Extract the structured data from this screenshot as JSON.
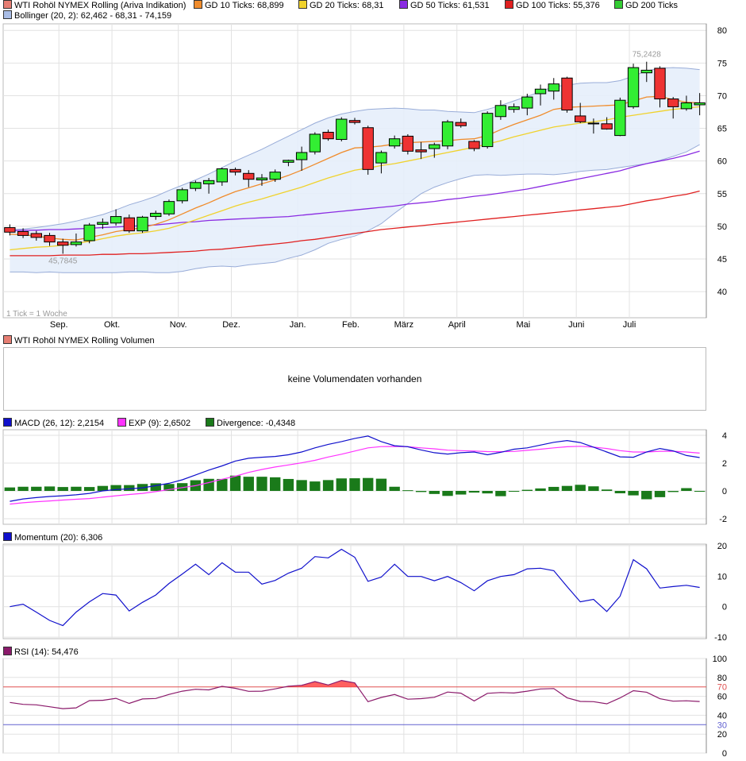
{
  "legend_main_1": [
    {
      "label": "WTI Rohöl NYMEX Rolling (Ariva Indikation)",
      "color": "#e67e73"
    },
    {
      "label": "GD 10 Ticks: 68,899",
      "color": "#f08c2c"
    },
    {
      "label": "GD 20 Ticks: 68,31",
      "color": "#f0d22c"
    },
    {
      "label": "GD 50 Ticks: 61,531",
      "color": "#8a2be2"
    },
    {
      "label": "GD 100 Ticks: 55,376",
      "color": "#e02020"
    },
    {
      "label": "GD 200 Ticks",
      "color": "#33cc33"
    }
  ],
  "legend_main_2": {
    "label": "Bollinger (20, 2): 62,462 - 68,31 - 74,159",
    "color": "#a9bde6"
  },
  "legend_volume": {
    "label": "WTI Rohöl NYMEX Rolling Volumen",
    "color": "#e67e73"
  },
  "no_volume_text": "keine Volumendaten vorhanden",
  "legend_macd": [
    {
      "label": "MACD (26, 12): 2,2154",
      "color": "#1010cc"
    },
    {
      "label": "EXP (9): 2,6502",
      "color": "#ff33ff"
    },
    {
      "label": "Divergence: -0,4348",
      "color": "#1a7a1a"
    }
  ],
  "legend_momentum": {
    "label": "Momentum (20): 6,306",
    "color": "#1010cc"
  },
  "legend_rsi": {
    "label": "RSI (14): 54,476",
    "color": "#8b1a6b"
  },
  "tick_note": "1 Tick = 1 Woche",
  "colors": {
    "up": "#33ee33",
    "down": "#ee3333",
    "band_fill": "#e6eefb",
    "band_line": "#98acd8"
  },
  "chart_data": [
    {
      "type": "candlestick",
      "x_labels": [
        "Sep.",
        "Okt.",
        "Nov.",
        "Dez.",
        "Jan.",
        "Feb.",
        "März",
        "April",
        "Mai",
        "Juni",
        "Juli"
      ],
      "x_label_positions": [
        4.2,
        8.2,
        13.2,
        17.2,
        22.2,
        26.2,
        30.2,
        34.2,
        39.2,
        43.2,
        47.2
      ],
      "ylim": [
        36,
        81
      ],
      "yticks": [
        40,
        45,
        50,
        55,
        60,
        65,
        70,
        75,
        80
      ],
      "annotations": [
        {
          "text": "75,2428",
          "x": 48,
          "y": 75.24
        },
        {
          "text": "45,7845",
          "x": 4,
          "y": 45.78
        }
      ],
      "candles": [
        {
          "o": 49.8,
          "h": 50.3,
          "l": 48.6,
          "c": 49.1
        },
        {
          "o": 49.2,
          "h": 49.7,
          "l": 48.2,
          "c": 48.6
        },
        {
          "o": 48.9,
          "h": 49.3,
          "l": 47.8,
          "c": 48.3
        },
        {
          "o": 48.6,
          "h": 49.0,
          "l": 47.0,
          "c": 47.6
        },
        {
          "o": 47.6,
          "h": 48.1,
          "l": 45.8,
          "c": 47.1
        },
        {
          "o": 47.2,
          "h": 48.9,
          "l": 46.9,
          "c": 47.6
        },
        {
          "o": 47.8,
          "h": 50.5,
          "l": 47.4,
          "c": 50.2
        },
        {
          "o": 50.3,
          "h": 51.2,
          "l": 49.6,
          "c": 50.6
        },
        {
          "o": 50.5,
          "h": 52.6,
          "l": 50.1,
          "c": 51.5
        },
        {
          "o": 51.3,
          "h": 51.8,
          "l": 49.0,
          "c": 49.3
        },
        {
          "o": 49.3,
          "h": 51.6,
          "l": 49.0,
          "c": 51.4
        },
        {
          "o": 51.5,
          "h": 52.4,
          "l": 51.0,
          "c": 52.0
        },
        {
          "o": 51.9,
          "h": 54.1,
          "l": 51.6,
          "c": 53.8
        },
        {
          "o": 53.9,
          "h": 55.9,
          "l": 53.5,
          "c": 55.6
        },
        {
          "o": 55.8,
          "h": 57.0,
          "l": 55.4,
          "c": 56.7
        },
        {
          "o": 56.5,
          "h": 57.4,
          "l": 55.0,
          "c": 57.0
        },
        {
          "o": 56.8,
          "h": 59.0,
          "l": 56.2,
          "c": 58.8
        },
        {
          "o": 58.7,
          "h": 59.0,
          "l": 57.8,
          "c": 58.3
        },
        {
          "o": 58.1,
          "h": 58.6,
          "l": 56.0,
          "c": 57.2
        },
        {
          "o": 57.1,
          "h": 58.0,
          "l": 56.2,
          "c": 57.4
        },
        {
          "o": 57.2,
          "h": 58.7,
          "l": 56.8,
          "c": 58.3
        },
        {
          "o": 59.8,
          "h": 60.2,
          "l": 59.2,
          "c": 60.1
        },
        {
          "o": 60.2,
          "h": 62.2,
          "l": 58.5,
          "c": 61.3
        },
        {
          "o": 61.4,
          "h": 64.4,
          "l": 61.0,
          "c": 64.1
        },
        {
          "o": 64.4,
          "h": 64.8,
          "l": 63.1,
          "c": 63.4
        },
        {
          "o": 63.3,
          "h": 66.7,
          "l": 63.0,
          "c": 66.4
        },
        {
          "o": 66.2,
          "h": 66.6,
          "l": 65.6,
          "c": 65.9
        },
        {
          "o": 65.1,
          "h": 65.4,
          "l": 57.9,
          "c": 58.7
        },
        {
          "o": 59.7,
          "h": 61.6,
          "l": 58.1,
          "c": 61.3
        },
        {
          "o": 62.3,
          "h": 63.9,
          "l": 61.9,
          "c": 63.4
        },
        {
          "o": 63.8,
          "h": 64.1,
          "l": 61.0,
          "c": 61.5
        },
        {
          "o": 61.7,
          "h": 62.9,
          "l": 60.3,
          "c": 61.4
        },
        {
          "o": 61.9,
          "h": 62.8,
          "l": 60.5,
          "c": 62.5
        },
        {
          "o": 62.3,
          "h": 66.3,
          "l": 61.8,
          "c": 66.0
        },
        {
          "o": 65.9,
          "h": 66.5,
          "l": 65.1,
          "c": 65.4
        },
        {
          "o": 63.0,
          "h": 63.2,
          "l": 61.5,
          "c": 61.9
        },
        {
          "o": 62.2,
          "h": 67.6,
          "l": 61.9,
          "c": 67.3
        },
        {
          "o": 66.8,
          "h": 69.3,
          "l": 66.3,
          "c": 68.5
        },
        {
          "o": 67.9,
          "h": 68.8,
          "l": 67.4,
          "c": 68.3
        },
        {
          "o": 68.1,
          "h": 70.3,
          "l": 67.0,
          "c": 69.8
        },
        {
          "o": 70.3,
          "h": 71.7,
          "l": 68.5,
          "c": 71.0
        },
        {
          "o": 70.7,
          "h": 72.7,
          "l": 69.4,
          "c": 71.8
        },
        {
          "o": 72.7,
          "h": 72.9,
          "l": 67.4,
          "c": 67.8
        },
        {
          "o": 66.9,
          "h": 68.9,
          "l": 65.8,
          "c": 66.0
        },
        {
          "o": 65.8,
          "h": 66.5,
          "l": 64.2,
          "c": 65.8
        },
        {
          "o": 65.7,
          "h": 66.7,
          "l": 64.8,
          "c": 64.9
        },
        {
          "o": 63.9,
          "h": 69.7,
          "l": 63.8,
          "c": 69.3
        },
        {
          "o": 68.3,
          "h": 74.9,
          "l": 68.0,
          "c": 74.3
        },
        {
          "o": 73.5,
          "h": 75.2,
          "l": 72.1,
          "c": 73.9
        },
        {
          "o": 74.2,
          "h": 74.5,
          "l": 68.2,
          "c": 69.5
        },
        {
          "o": 69.5,
          "h": 69.8,
          "l": 66.5,
          "c": 68.3
        },
        {
          "o": 68.0,
          "h": 70.0,
          "l": 67.7,
          "c": 68.9
        },
        {
          "o": 68.6,
          "h": 70.4,
          "l": 67.0,
          "c": 68.9
        }
      ],
      "gd10": [
        48.8,
        48.7,
        48.5,
        48.2,
        48.0,
        47.9,
        48.3,
        48.7,
        49.2,
        49.5,
        49.8,
        50.3,
        51.0,
        51.9,
        52.8,
        53.6,
        54.5,
        55.3,
        55.9,
        56.5,
        57.1,
        57.8,
        58.6,
        59.5,
        60.4,
        61.3,
        62.0,
        62.1,
        62.3,
        62.6,
        62.8,
        62.9,
        63.0,
        63.1,
        63.3,
        63.4,
        63.9,
        64.8,
        65.6,
        66.3,
        67.0,
        67.9,
        68.2,
        68.3,
        68.4,
        68.5,
        68.6,
        69.2,
        69.8,
        69.9,
        69.4,
        69.0,
        68.9
      ],
      "gd20": [
        46.4,
        46.6,
        46.8,
        46.9,
        47.1,
        47.4,
        47.7,
        48.1,
        48.5,
        48.8,
        49.0,
        49.3,
        49.7,
        50.3,
        51.0,
        51.7,
        52.4,
        53.1,
        53.7,
        54.2,
        54.8,
        55.4,
        56.0,
        56.7,
        57.4,
        58.0,
        58.6,
        58.9,
        59.3,
        59.6,
        60.0,
        60.4,
        60.9,
        61.3,
        61.7,
        62.1,
        62.6,
        63.1,
        63.7,
        64.2,
        64.7,
        65.2,
        65.5,
        65.8,
        66.0,
        66.3,
        66.7,
        67.0,
        67.3,
        67.6,
        67.9,
        68.1,
        68.3
      ],
      "gd50": [
        49.3,
        49.4,
        49.4,
        49.5,
        49.5,
        49.6,
        49.7,
        49.8,
        49.9,
        50.0,
        50.1,
        50.2,
        50.4,
        50.6,
        50.7,
        50.9,
        51.0,
        51.1,
        51.2,
        51.3,
        51.4,
        51.5,
        51.7,
        51.9,
        52.1,
        52.3,
        52.5,
        52.7,
        52.9,
        53.1,
        53.4,
        53.6,
        53.8,
        54.1,
        54.3,
        54.6,
        54.8,
        55.1,
        55.4,
        55.7,
        56.1,
        56.5,
        56.9,
        57.3,
        57.7,
        58.1,
        58.5,
        59.1,
        59.6,
        60.0,
        60.4,
        60.9,
        61.5
      ],
      "gd100": [
        45.5,
        45.5,
        45.5,
        45.5,
        45.6,
        45.6,
        45.6,
        45.7,
        45.7,
        45.8,
        45.8,
        45.9,
        46.0,
        46.1,
        46.2,
        46.4,
        46.5,
        46.7,
        46.9,
        47.1,
        47.3,
        47.5,
        47.8,
        48.0,
        48.3,
        48.6,
        48.9,
        49.2,
        49.5,
        49.7,
        49.9,
        50.1,
        50.3,
        50.5,
        50.7,
        50.9,
        51.1,
        51.3,
        51.5,
        51.7,
        51.9,
        52.1,
        52.3,
        52.5,
        52.7,
        52.9,
        53.1,
        53.5,
        53.9,
        54.2,
        54.6,
        54.9,
        55.4
      ],
      "boll_upper": [
        49.5,
        49.6,
        49.8,
        50.1,
        50.4,
        50.8,
        51.3,
        51.8,
        52.5,
        53.3,
        53.9,
        54.6,
        55.5,
        56.3,
        57.1,
        58.0,
        59.0,
        60.0,
        60.9,
        61.8,
        62.8,
        63.8,
        64.8,
        65.8,
        66.6,
        67.2,
        67.6,
        67.9,
        68.0,
        68.1,
        68.0,
        67.8,
        67.8,
        67.6,
        67.5,
        67.4,
        67.9,
        68.5,
        69.2,
        69.9,
        70.6,
        71.4,
        71.6,
        71.9,
        72.0,
        72.0,
        72.3,
        73.0,
        73.8,
        74.2,
        74.3,
        74.2,
        74.0
      ],
      "boll_lower": [
        43.0,
        43.0,
        42.9,
        43.0,
        42.9,
        42.9,
        42.9,
        42.9,
        42.9,
        43.0,
        43.0,
        42.9,
        42.9,
        43.1,
        43.5,
        43.8,
        43.9,
        43.8,
        44.1,
        44.3,
        44.5,
        45.1,
        45.6,
        46.4,
        47.4,
        48.0,
        48.5,
        49.3,
        50.4,
        52.0,
        53.5,
        55.0,
        56.0,
        56.7,
        57.3,
        57.8,
        57.9,
        57.8,
        57.9,
        58.0,
        58.0,
        57.9,
        58.1,
        58.4,
        58.6,
        58.7,
        59.0,
        59.3,
        59.6,
        60.1,
        60.7,
        61.4,
        62.5
      ]
    },
    {
      "type": "bar_line",
      "title": "MACD",
      "ylim": [
        -2.4,
        4.4
      ],
      "yticks": [
        -2,
        0,
        2,
        4
      ],
      "macd": [
        -0.75,
        -0.58,
        -0.48,
        -0.4,
        -0.35,
        -0.28,
        -0.18,
        0.0,
        0.1,
        0.15,
        0.22,
        0.38,
        0.55,
        0.8,
        1.15,
        1.5,
        1.8,
        2.15,
        2.35,
        2.42,
        2.48,
        2.6,
        2.8,
        3.1,
        3.35,
        3.55,
        3.78,
        3.95,
        3.55,
        3.25,
        3.18,
        2.95,
        2.75,
        2.65,
        2.75,
        2.8,
        2.6,
        2.78,
        3.0,
        3.1,
        3.3,
        3.5,
        3.62,
        3.48,
        3.15,
        2.8,
        2.45,
        2.42,
        2.8,
        3.05,
        2.88,
        2.55,
        2.4,
        2.2
      ],
      "exp": [
        -0.95,
        -0.85,
        -0.78,
        -0.72,
        -0.66,
        -0.6,
        -0.55,
        -0.45,
        -0.35,
        -0.26,
        -0.18,
        -0.05,
        0.1,
        0.24,
        0.38,
        0.6,
        0.84,
        1.06,
        1.33,
        1.54,
        1.72,
        1.87,
        2.02,
        2.2,
        2.44,
        2.64,
        2.87,
        3.1,
        3.19,
        3.2,
        3.18,
        3.1,
        3.03,
        2.93,
        2.9,
        2.87,
        2.83,
        2.82,
        2.84,
        2.92,
        3.0,
        3.1,
        3.18,
        3.21,
        3.15,
        3.05,
        2.9,
        2.8,
        2.8,
        2.85,
        2.85,
        2.8,
        2.72,
        2.65
      ],
      "divergence": [
        0.25,
        0.3,
        0.3,
        0.32,
        0.28,
        0.3,
        0.28,
        0.36,
        0.42,
        0.42,
        0.5,
        0.55,
        0.5,
        0.56,
        0.77,
        0.87,
        0.86,
        1.1,
        1.02,
        1.02,
        0.98,
        0.86,
        0.78,
        0.68,
        0.78,
        0.9,
        0.91,
        0.93,
        0.88,
        0.3,
        0.05,
        -0.08,
        -0.22,
        -0.36,
        -0.26,
        -0.12,
        -0.18,
        -0.38,
        -0.04,
        0.08,
        0.18,
        0.29,
        0.36,
        0.44,
        0.33,
        0.1,
        -0.17,
        -0.32,
        -0.6,
        -0.45,
        -0.08,
        0.2,
        -0.03,
        -0.32,
        -0.43
      ]
    },
    {
      "type": "line",
      "title": "Momentum",
      "ylim": [
        -10.5,
        20.5
      ],
      "yticks": [
        -10,
        0,
        10,
        20
      ],
      "values": [
        0.0,
        0.8,
        -1.8,
        -4.5,
        -6.2,
        -1.8,
        1.6,
        4.3,
        3.8,
        -1.4,
        1.4,
        3.8,
        7.6,
        10.7,
        13.9,
        10.5,
        14.4,
        11.3,
        11.3,
        7.4,
        8.6,
        11.0,
        12.6,
        16.4,
        16.0,
        18.8,
        16.2,
        8.3,
        9.7,
        13.9,
        9.9,
        9.9,
        8.5,
        9.9,
        7.9,
        5.2,
        8.5,
        9.9,
        10.5,
        12.4,
        12.6,
        11.8,
        6.6,
        1.6,
        2.4,
        -1.6,
        3.4,
        15.4,
        12.4,
        6.1,
        6.6,
        7.0,
        6.3
      ]
    },
    {
      "type": "line",
      "title": "RSI",
      "ylim": [
        0,
        100
      ],
      "yticks": [
        0,
        20,
        30,
        40,
        60,
        70,
        80,
        100
      ],
      "levels": [
        30,
        70
      ],
      "values": [
        53.5,
        51.5,
        51.0,
        49.0,
        47.0,
        47.8,
        55.5,
        55.8,
        57.9,
        52.5,
        57.2,
        57.7,
        62.0,
        65.5,
        67.5,
        66.8,
        70.6,
        68.5,
        65.3,
        65.5,
        67.9,
        70.7,
        71.7,
        75.6,
        72.0,
        76.8,
        74.2,
        54.4,
        58.8,
        61.9,
        57.0,
        57.6,
        59.0,
        64.5,
        63.4,
        55.1,
        63.2,
        64.0,
        63.5,
        65.5,
        67.8,
        68.2,
        58.5,
        54.6,
        54.4,
        52.1,
        58.3,
        66.0,
        64.4,
        57.5,
        54.9,
        55.3,
        54.5
      ]
    }
  ]
}
